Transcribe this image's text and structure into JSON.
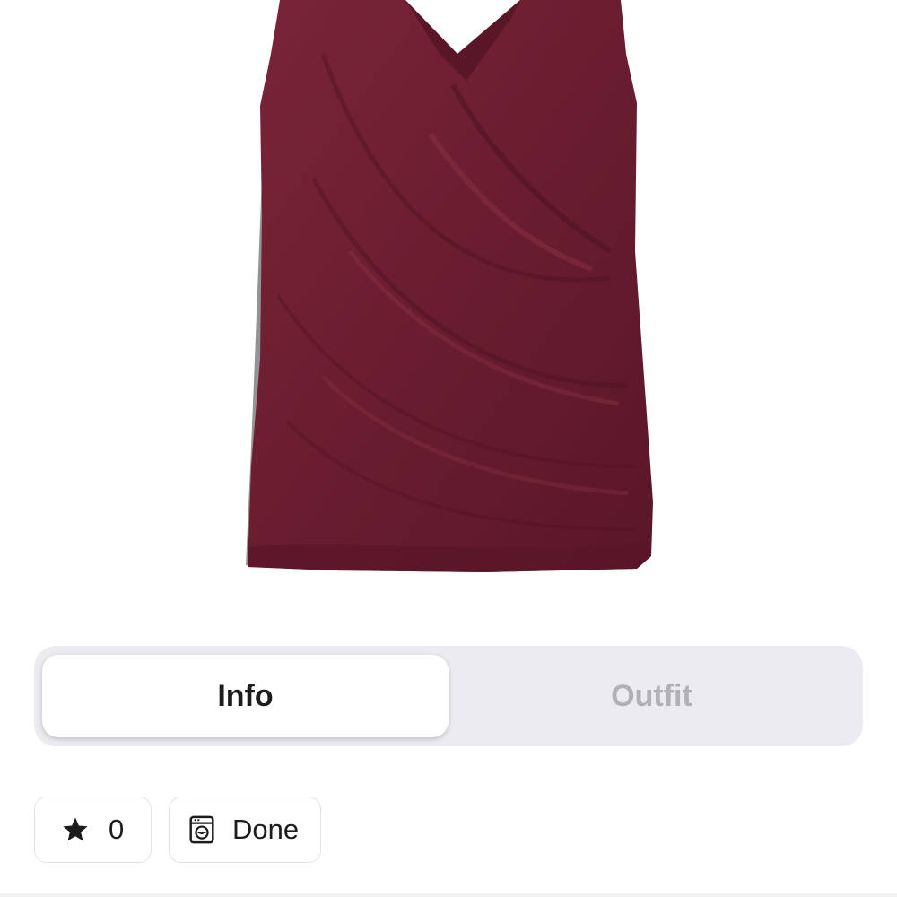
{
  "product": {
    "image_icon": "burgundy-sleeveless-wrap-top",
    "garment_color": "#6e1f33"
  },
  "segmented": {
    "options": [
      {
        "label": "Info",
        "selected": true
      },
      {
        "label": "Outfit",
        "selected": false
      }
    ]
  },
  "chips": {
    "rating": {
      "icon": "star-icon",
      "value": "0"
    },
    "wash": {
      "icon": "washing-machine-icon",
      "label": "Done"
    }
  },
  "colors": {
    "segment_track": "#ebebf0",
    "segment_selected": "#ffffff",
    "segment_unselected_text": "#b0b0b5",
    "text_primary": "#1c1c1e"
  }
}
